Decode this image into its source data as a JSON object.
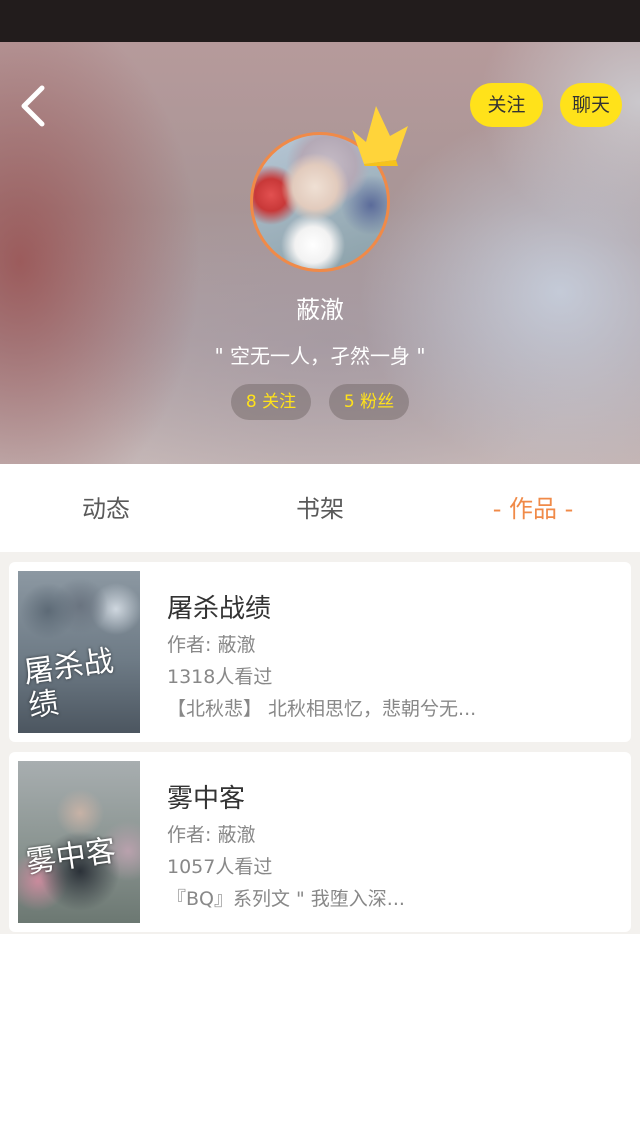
{
  "header": {
    "follow_label": "关注",
    "chat_label": "聊天",
    "nickname": "蔽澈",
    "signature": "\" 空无一人，孑然一身 \"",
    "following_stat": "8 关注",
    "fans_stat": "5 粉丝",
    "accent_color": "#ffe21a",
    "avatar_border_color": "#f08a48"
  },
  "tabs": {
    "dynamic": "动态",
    "shelf": "书架",
    "works": "- 作品 -",
    "active": "works",
    "active_color": "#f08a48"
  },
  "works": [
    {
      "cover_text": "屠杀战绩",
      "title": "屠杀战绩",
      "author": "作者: 蔽澈",
      "views": "1318人看过",
      "description": "【北秋悲】 北秋相思忆，悲朝兮无..."
    },
    {
      "cover_text": "雾中客",
      "title": "雾中客",
      "author": "作者: 蔽澈",
      "views": "1057人看过",
      "description": "『BQ』系列文 \" 我堕入深..."
    }
  ],
  "icons": {
    "back": "chevron-left-icon",
    "crown": "crown-icon"
  }
}
